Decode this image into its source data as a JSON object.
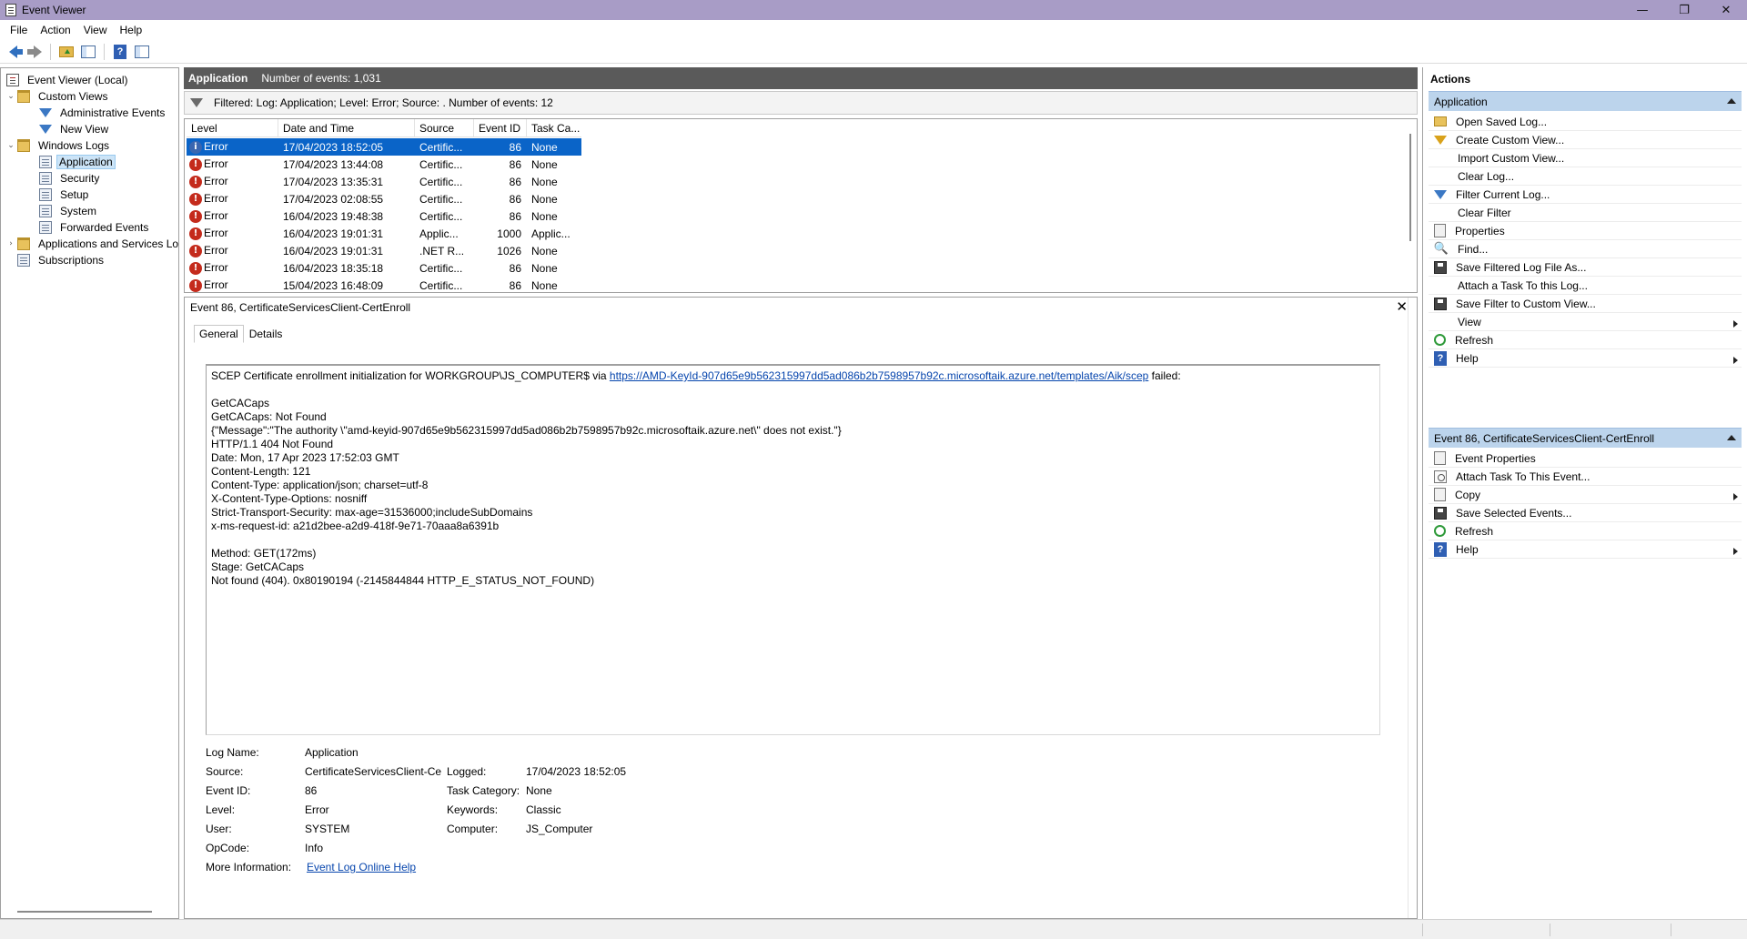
{
  "window": {
    "title": "Event Viewer",
    "controls": {
      "minimize": "—",
      "restore": "❐",
      "close": "✕"
    }
  },
  "menu": [
    "File",
    "Action",
    "View",
    "Help"
  ],
  "toolbar": {
    "icons": [
      "back-arrow-icon",
      "forward-arrow-icon",
      "up-folder-icon",
      "show-hide-tree-icon",
      "help-icon",
      "show-hide-action-pane-icon"
    ]
  },
  "tree": {
    "root": "Event Viewer (Local)",
    "custom_views": "Custom Views",
    "administrative_events": "Administrative Events",
    "new_view": "New View",
    "windows_logs": "Windows Logs",
    "application": "Application",
    "security": "Security",
    "setup": "Setup",
    "system": "System",
    "forwarded_events": "Forwarded Events",
    "apps_services": "Applications and Services Lo",
    "subscriptions": "Subscriptions"
  },
  "center": {
    "header_title": "Application",
    "header_count": "Number of events: 1,031",
    "filter_text": "Filtered: Log: Application; Level: Error; Source: . Number of events: 12"
  },
  "events": {
    "columns": [
      "Level",
      "Date and Time",
      "Source",
      "Event ID",
      "Task Ca..."
    ],
    "rows": [
      {
        "level": "Error",
        "date": "17/04/2023 18:52:05",
        "source": "Certific...",
        "id": "86",
        "task": "None"
      },
      {
        "level": "Error",
        "date": "17/04/2023 13:44:08",
        "source": "Certific...",
        "id": "86",
        "task": "None"
      },
      {
        "level": "Error",
        "date": "17/04/2023 13:35:31",
        "source": "Certific...",
        "id": "86",
        "task": "None"
      },
      {
        "level": "Error",
        "date": "17/04/2023 02:08:55",
        "source": "Certific...",
        "id": "86",
        "task": "None"
      },
      {
        "level": "Error",
        "date": "16/04/2023 19:48:38",
        "source": "Certific...",
        "id": "86",
        "task": "None"
      },
      {
        "level": "Error",
        "date": "16/04/2023 19:01:31",
        "source": "Applic...",
        "id": "1000",
        "task": "Applic..."
      },
      {
        "level": "Error",
        "date": "16/04/2023 19:01:31",
        "source": ".NET R...",
        "id": "1026",
        "task": "None"
      },
      {
        "level": "Error",
        "date": "16/04/2023 18:35:18",
        "source": "Certific...",
        "id": "86",
        "task": "None"
      },
      {
        "level": "Error",
        "date": "15/04/2023 16:48:09",
        "source": "Certific...",
        "id": "86",
        "task": "None"
      }
    ]
  },
  "detail": {
    "title": "Event 86, CertificateServicesClient-CertEnroll",
    "tabs": [
      "General",
      "Details"
    ],
    "desc_first_prefix": "SCEP Certificate enrollment initialization for WORKGROUP\\JS_COMPUTER$ via ",
    "desc_first_link": "https://AMD-KeyId-907d65e9b562315997dd5ad086b2b7598957b92c.microsoftaik.azure.net/templates/Aik/scep",
    "desc_first_suffix": " failed:",
    "desc_lines": [
      "",
      "GetCACaps",
      "GetCACaps: Not Found",
      "{\"Message\":\"The authority \\\"amd-keyid-907d65e9b562315997dd5ad086b2b7598957b92c.microsoftaik.azure.net\\\" does not exist.\"}",
      "HTTP/1.1 404 Not Found",
      "Date: Mon, 17 Apr 2023 17:52:03 GMT",
      "Content-Length: 121",
      "Content-Type: application/json; charset=utf-8",
      "X-Content-Type-Options: nosniff",
      "Strict-Transport-Security: max-age=31536000;includeSubDomains",
      "x-ms-request-id: a21d2bee-a2d9-418f-9e71-70aaa8a6391b",
      "",
      "Method: GET(172ms)",
      "Stage: GetCACaps",
      "Not found (404). 0x80190194 (-2145844844 HTTP_E_STATUS_NOT_FOUND)"
    ],
    "props": {
      "log_name_label": "Log Name:",
      "log_name": "Application",
      "source_label": "Source:",
      "source": "CertificateServicesClient-Cer",
      "logged_label": "Logged:",
      "logged": "17/04/2023 18:52:05",
      "event_id_label": "Event ID:",
      "event_id": "86",
      "task_label": "Task Category:",
      "task": "None",
      "level_label": "Level:",
      "level": "Error",
      "keywords_label": "Keywords:",
      "keywords": "Classic",
      "user_label": "User:",
      "user": "SYSTEM",
      "computer_label": "Computer:",
      "computer": "JS_Computer",
      "opcode_label": "OpCode:",
      "opcode": "Info",
      "more_info_label": "More Information:",
      "more_info_link": "Event Log Online Help"
    }
  },
  "actions": {
    "title": "Actions",
    "section1": "Application",
    "items1": [
      "Open Saved Log...",
      "Create Custom View...",
      "Import Custom View...",
      "Clear Log...",
      "Filter Current Log...",
      "Clear Filter",
      "Properties",
      "Find...",
      "Save Filtered Log File As...",
      "Attach a Task To this Log...",
      "Save Filter to Custom View...",
      "View",
      "Refresh",
      "Help"
    ],
    "section2": "Event 86, CertificateServicesClient-CertEnroll",
    "items2": [
      "Event Properties",
      "Attach Task To This Event...",
      "Copy",
      "Save Selected Events...",
      "Refresh",
      "Help"
    ]
  }
}
